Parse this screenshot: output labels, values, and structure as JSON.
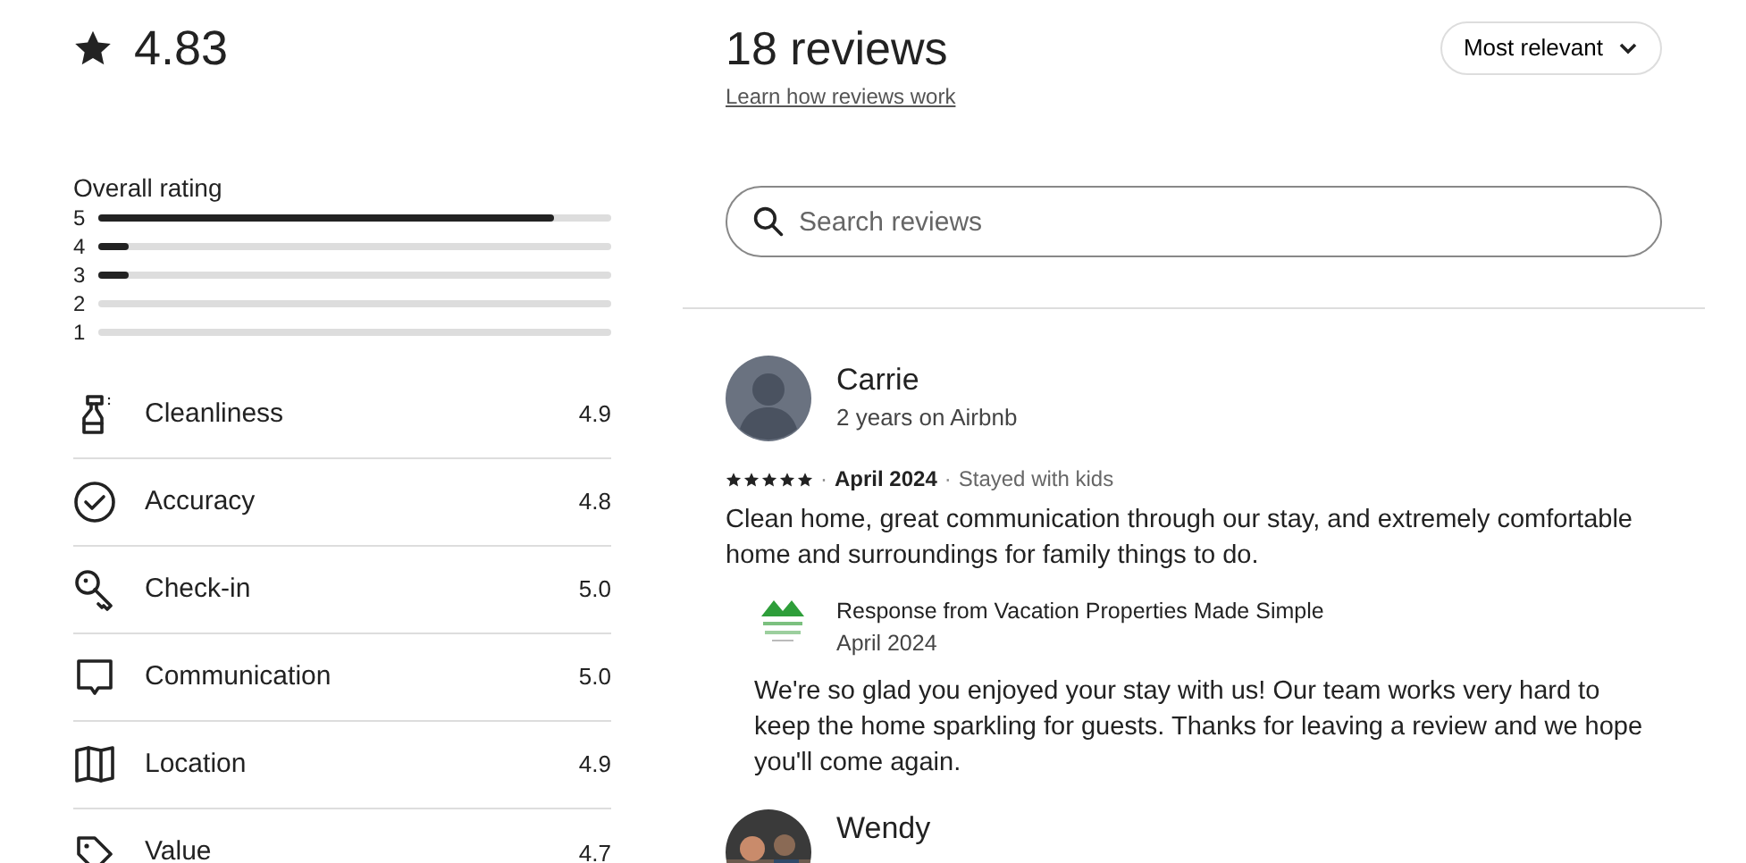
{
  "overall": {
    "score": "4.83",
    "label": "Overall rating"
  },
  "distribution": [
    {
      "label": "5",
      "level": 0.89
    },
    {
      "label": "4",
      "level": 0.06
    },
    {
      "label": "3",
      "level": 0.06
    },
    {
      "label": "2"
    },
    {
      "label": "1"
    }
  ],
  "categories": [
    {
      "kind": "spray",
      "label": "Cleanliness",
      "score": "4.9"
    },
    {
      "kind": "check",
      "label": "Accuracy",
      "score": "4.8"
    },
    {
      "kind": "key",
      "label": "Check-in",
      "score": "5.0"
    },
    {
      "kind": "chat",
      "label": "Communication",
      "score": "5.0"
    },
    {
      "kind": "map",
      "label": "Location",
      "score": "4.9"
    },
    {
      "kind": "tag",
      "label": "Value",
      "score": "4.7"
    }
  ],
  "header": {
    "title": "18 reviews",
    "link": "Learn how reviews work",
    "sort": "Most relevant"
  },
  "search": {
    "placeholder": "Search reviews"
  },
  "reviews": [
    {
      "name": "Carrie",
      "tenure": "2 years on Airbnb",
      "stars": 5,
      "separator": "·",
      "date": "April 2024",
      "separator_2": "·",
      "trip": "Stayed with kids",
      "text": "Clean home, great communication through our stay, and extremely comfortable home and surroundings for family things to do.",
      "response": {
        "title": "Response from Vacation Properties Made Simple",
        "date": "April 2024",
        "text": "We're so glad you enjoyed your stay with us! Our team works very hard to keep the home sparkling for guests. Thanks for leaving a review and we hope you'll come again."
      }
    },
    {
      "name": "Wendy"
    }
  ]
}
